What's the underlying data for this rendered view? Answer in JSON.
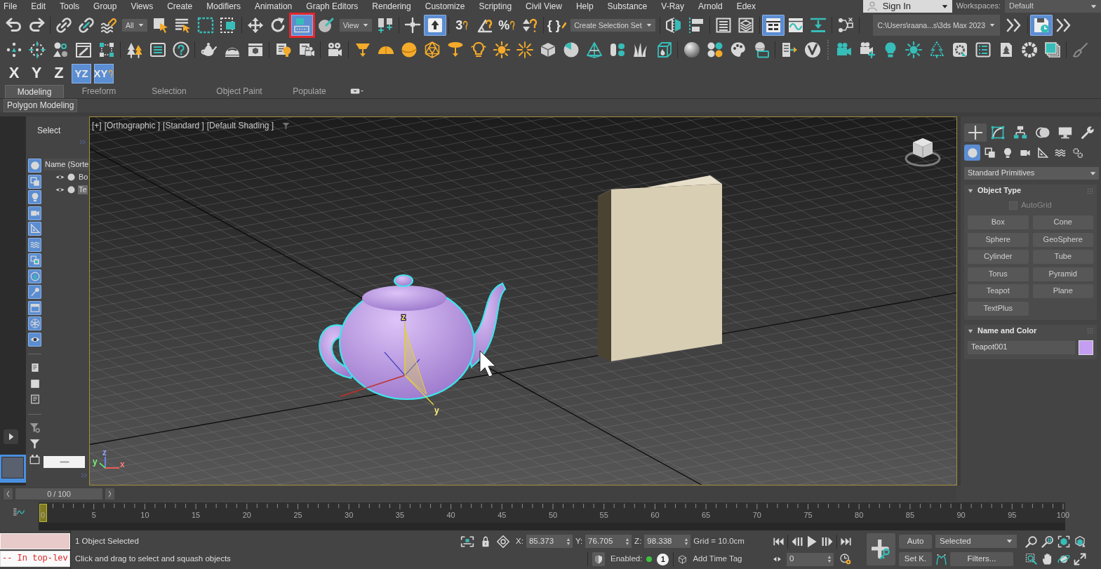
{
  "menu_bar": {
    "items": [
      "File",
      "Edit",
      "Tools",
      "Group",
      "Views",
      "Create",
      "Modifiers",
      "Animation",
      "Graph Editors",
      "Rendering",
      "Customize",
      "Scripting",
      "Civil View",
      "Help",
      "Substance",
      "V-Ray",
      "Arnold",
      "Edex"
    ],
    "sign_in": "Sign In",
    "workspaces_label": "Workspaces:",
    "workspace": "Default"
  },
  "main_toolbar": [
    {
      "kind": "button",
      "selected": false,
      "highlighted": false
    },
    {
      "kind": "button",
      "selected": false,
      "highlighted": false
    },
    {
      "kind": "separator"
    },
    {
      "kind": "button",
      "selected": false,
      "highlighted": false
    },
    {
      "kind": "button",
      "selected": false,
      "highlighted": false
    },
    {
      "kind": "button",
      "selected": false,
      "highlighted": false
    },
    {
      "kind": "dropdown",
      "value": "All"
    },
    {
      "kind": "button",
      "selected": false,
      "highlighted": false
    },
    {
      "kind": "button",
      "selected": false,
      "highlighted": false
    },
    {
      "kind": "button",
      "selected": false,
      "highlighted": false
    },
    {
      "kind": "button",
      "selected": false,
      "highlighted": false
    },
    {
      "kind": "separator"
    },
    {
      "kind": "button",
      "selected": false,
      "highlighted": false
    },
    {
      "kind": "button",
      "selected": false,
      "highlighted": false
    },
    {
      "kind": "button",
      "selected": true,
      "highlighted": true
    },
    {
      "kind": "button",
      "selected": false,
      "highlighted": false
    },
    {
      "kind": "dropdown",
      "value": "View"
    },
    {
      "kind": "button",
      "selected": false,
      "highlighted": false
    },
    {
      "kind": "separator"
    },
    {
      "kind": "button",
      "selected": false,
      "highlighted": false
    },
    {
      "kind": "button",
      "selected": true,
      "highlighted": false
    },
    {
      "kind": "separator"
    },
    {
      "kind": "button",
      "selected": false,
      "highlighted": false,
      "glyph": "3"
    },
    {
      "kind": "button",
      "selected": false,
      "highlighted": false
    },
    {
      "kind": "button",
      "selected": false,
      "highlighted": false,
      "glyph": "%"
    },
    {
      "kind": "button",
      "selected": false,
      "highlighted": false
    },
    {
      "kind": "separator"
    },
    {
      "kind": "button",
      "selected": false,
      "highlighted": false,
      "glyph": "{ }"
    },
    {
      "kind": "dropdown",
      "value": "Create Selection Set"
    },
    {
      "kind": "separator"
    },
    {
      "kind": "button",
      "selected": false,
      "highlighted": false
    },
    {
      "kind": "button",
      "selected": false,
      "highlighted": false
    },
    {
      "kind": "separator"
    },
    {
      "kind": "button",
      "selected": false,
      "highlighted": false
    },
    {
      "kind": "button",
      "selected": false,
      "highlighted": false
    },
    {
      "kind": "separator"
    },
    {
      "kind": "button",
      "selected": true,
      "highlighted": false
    },
    {
      "kind": "button",
      "selected": false,
      "highlighted": false
    },
    {
      "kind": "button",
      "selected": false,
      "highlighted": false
    },
    {
      "kind": "separator"
    },
    {
      "kind": "button",
      "selected": false,
      "highlighted": false
    },
    {
      "kind": "separator"
    },
    {
      "kind": "dropdown",
      "value": "C:\\Users\\raana...s\\3ds Max 2023"
    },
    {
      "kind": "button",
      "selected": false,
      "highlighted": false
    },
    {
      "kind": "separator"
    },
    {
      "kind": "button",
      "selected": true,
      "highlighted": false
    },
    {
      "kind": "button",
      "selected": false,
      "highlighted": false
    }
  ],
  "axis_constraints": [
    {
      "label": "X",
      "selected": false
    },
    {
      "label": "Y",
      "selected": false
    },
    {
      "label": "Z",
      "selected": false
    },
    {
      "label": "YZ",
      "selected": true
    },
    {
      "label": "XY",
      "selected": true
    }
  ],
  "ribbon": {
    "tabs": [
      {
        "label": "Modeling",
        "selected": true
      },
      {
        "label": "Freeform",
        "selected": false
      },
      {
        "label": "Selection",
        "selected": false
      },
      {
        "label": "Object Paint",
        "selected": false
      },
      {
        "label": "Populate",
        "selected": false
      }
    ],
    "panel": "Polygon Modeling"
  },
  "scene_explorer": {
    "title": "Select",
    "filters": [
      {
        "on": true
      },
      {
        "on": true
      },
      {
        "on": true
      },
      {
        "on": true
      },
      {
        "on": true
      },
      {
        "on": true
      },
      {
        "on": true
      },
      {
        "on": true
      },
      {
        "on": true
      },
      {
        "on": true
      },
      {
        "on": true
      },
      {
        "on": true
      }
    ],
    "column": "Name (Sorte",
    "rows": [
      {
        "name": "Bo",
        "selected": false
      },
      {
        "name": "Te",
        "selected": true
      }
    ]
  },
  "viewport": {
    "labels": [
      "[+]",
      "[Orthographic ]",
      "[Standard ]",
      "[Default Shading ]"
    ],
    "gizmo_labels": [
      "z",
      "y"
    ],
    "axis_tripod": [
      "z",
      "y",
      "x"
    ]
  },
  "command_panel": {
    "tabs": [
      {
        "selected": true
      },
      {
        "selected": false
      },
      {
        "selected": false
      },
      {
        "selected": false
      },
      {
        "selected": false
      },
      {
        "selected": false
      }
    ],
    "categories": [
      {
        "selected": true
      },
      {
        "selected": false
      },
      {
        "selected": false
      },
      {
        "selected": false
      },
      {
        "selected": false
      },
      {
        "selected": false
      },
      {
        "selected": false
      }
    ],
    "dropdown": "Standard Primitives",
    "object_type": {
      "title": "Object Type",
      "autogrid": {
        "label": "AutoGrid",
        "checked": false,
        "disabled": true
      },
      "buttons": [
        "Box",
        "Cone",
        "Sphere",
        "GeoSphere",
        "Cylinder",
        "Tube",
        "Torus",
        "Pyramid",
        "Teapot",
        "Plane",
        "TextPlus"
      ]
    },
    "name_and_color": {
      "title": "Name and Color",
      "name": "Teapot001",
      "color": "#c49ef0"
    }
  },
  "time_slider": {
    "label": "0 / 100",
    "level": 0
  },
  "timeline": {
    "labels": [
      "0",
      "5",
      "10",
      "15",
      "20",
      "25",
      "30",
      "35",
      "40",
      "45",
      "50",
      "55",
      "60",
      "65",
      "70",
      "75",
      "80",
      "85",
      "90",
      "95",
      "100"
    ],
    "level": 0
  },
  "status_bar": {
    "listener_output": "-- In top-lev",
    "selection_info": "1 Object Selected",
    "prompt": "Click and drag to select and squash objects",
    "coordinates": [
      {
        "label": "X:",
        "value": "85.373"
      },
      {
        "label": "Y:",
        "value": "76.705"
      },
      {
        "label": "Z:",
        "value": "98.338"
      }
    ],
    "grid": "Grid = 10.0cm",
    "enabled_label": "Enabled:",
    "enabled": true,
    "badge": "1",
    "time_tag": "Add Time Tag"
  },
  "playback": {
    "frame": "0"
  },
  "key_controls": {
    "auto": "Auto",
    "set_key": "Set K.",
    "key_filter": "Selected",
    "filters": "Filters..."
  }
}
